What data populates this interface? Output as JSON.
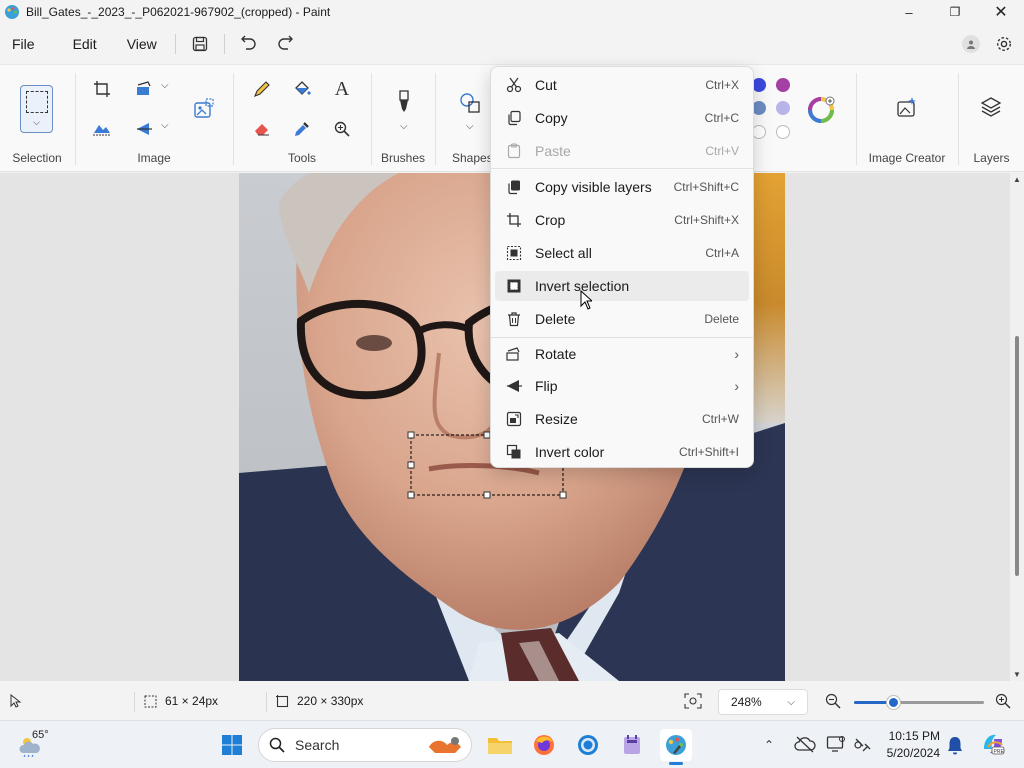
{
  "window": {
    "title": "Bill_Gates_-_2023_-_P062021-967902_(cropped) - Paint"
  },
  "menubar": {
    "file": "File",
    "edit": "Edit",
    "view": "View"
  },
  "ribbon": {
    "groups": {
      "selection": "Selection",
      "image": "Image",
      "tools": "Tools",
      "brushes": "Brushes",
      "shapes": "Shapes",
      "image_creator": "Image Creator",
      "layers": "Layers"
    },
    "colors": {
      "blue": "#3b49df",
      "purple": "#a43fa3",
      "steel": "#6b8cc2",
      "lavender": "#b8b3e8"
    }
  },
  "context_menu": {
    "items": [
      {
        "label": "Cut",
        "shortcut": "Ctrl+X",
        "icon": "scissors-icon"
      },
      {
        "label": "Copy",
        "shortcut": "Ctrl+C",
        "icon": "copy-icon"
      },
      {
        "label": "Paste",
        "shortcut": "Ctrl+V",
        "icon": "paste-icon",
        "disabled": true
      },
      {
        "label": "Copy visible layers",
        "shortcut": "Ctrl+Shift+C",
        "icon": "copy-layers-icon"
      },
      {
        "label": "Crop",
        "shortcut": "Ctrl+Shift+X",
        "icon": "crop-icon"
      },
      {
        "label": "Select all",
        "shortcut": "Ctrl+A",
        "icon": "select-all-icon"
      },
      {
        "label": "Invert selection",
        "shortcut": "",
        "icon": "invert-selection-icon"
      },
      {
        "label": "Delete",
        "shortcut": "Delete",
        "icon": "trash-icon"
      },
      {
        "label": "Rotate",
        "shortcut": "",
        "icon": "rotate-icon",
        "submenu": true
      },
      {
        "label": "Flip",
        "shortcut": "",
        "icon": "flip-icon",
        "submenu": true
      },
      {
        "label": "Resize",
        "shortcut": "Ctrl+W",
        "icon": "resize-icon"
      },
      {
        "label": "Invert color",
        "shortcut": "Ctrl+Shift+I",
        "icon": "invert-color-icon"
      }
    ]
  },
  "statusbar": {
    "selection_size": "61 × 24px",
    "image_size": "220 × 330px",
    "zoom": "248%",
    "zoom_slider": 0.3
  },
  "taskbar": {
    "weather_temp": "65°",
    "search_label": "Search",
    "time": "10:15 PM",
    "date": "5/20/2024"
  }
}
